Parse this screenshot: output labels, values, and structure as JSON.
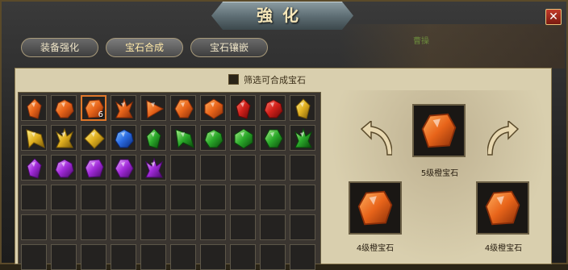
{
  "window": {
    "title": "強化",
    "close_label": "✕"
  },
  "background": {
    "scene_text": "曹操"
  },
  "tabs": [
    {
      "label": "装备强化",
      "active": false
    },
    {
      "label": "宝石合成",
      "active": true
    },
    {
      "label": "宝石镶嵌",
      "active": false
    }
  ],
  "filter": {
    "label": "筛选可合成宝石",
    "checked": false
  },
  "inventory": {
    "rows": 6,
    "cols": 10,
    "selected_index": 2,
    "items": [
      {
        "color": "orange",
        "shape": "shard"
      },
      {
        "color": "orange",
        "shape": "round"
      },
      {
        "color": "orange",
        "shape": "chunk",
        "count": "6"
      },
      {
        "color": "orange",
        "shape": "crystal"
      },
      {
        "color": "orange",
        "shape": "triangle"
      },
      {
        "color": "orange",
        "shape": "hex"
      },
      {
        "color": "orange",
        "shape": "faceted"
      },
      {
        "color": "red",
        "shape": "shard"
      },
      {
        "color": "red",
        "shape": "round"
      },
      {
        "color": "yellow",
        "shape": "shard"
      },
      {
        "color": "yellow",
        "shape": "spike"
      },
      {
        "color": "yellow",
        "shape": "crystal"
      },
      {
        "color": "yellow",
        "shape": "diamond"
      },
      {
        "color": "blue",
        "shape": "round"
      },
      {
        "color": "green",
        "shape": "shard"
      },
      {
        "color": "green",
        "shape": "spike"
      },
      {
        "color": "green",
        "shape": "round"
      },
      {
        "color": "green",
        "shape": "faceted"
      },
      {
        "color": "green",
        "shape": "hex"
      },
      {
        "color": "green",
        "shape": "crystal"
      },
      {
        "color": "purple",
        "shape": "shard"
      },
      {
        "color": "purple",
        "shape": "round"
      },
      {
        "color": "purple",
        "shape": "chunk"
      },
      {
        "color": "purple",
        "shape": "hex"
      },
      {
        "color": "purple",
        "shape": "crystal"
      }
    ]
  },
  "synthesis": {
    "result": {
      "label": "5级橙宝石",
      "color": "orange"
    },
    "materials": [
      {
        "label": "4级橙宝石",
        "color": "orange"
      },
      {
        "label": "4级橙宝石",
        "color": "orange"
      }
    ]
  },
  "colors": {
    "orange": [
      "#ffb060",
      "#e8641a",
      "#8a2e08"
    ],
    "red": [
      "#ff7a6a",
      "#d0201a",
      "#6a0808"
    ],
    "yellow": [
      "#fff08a",
      "#e0b020",
      "#7a5a08"
    ],
    "blue": [
      "#8ac8ff",
      "#2a6ae0",
      "#0a2a7a"
    ],
    "green": [
      "#a8f08a",
      "#2aa82a",
      "#0a4a0a"
    ],
    "purple": [
      "#e8a8ff",
      "#a02ad8",
      "#4a0a6a"
    ]
  }
}
